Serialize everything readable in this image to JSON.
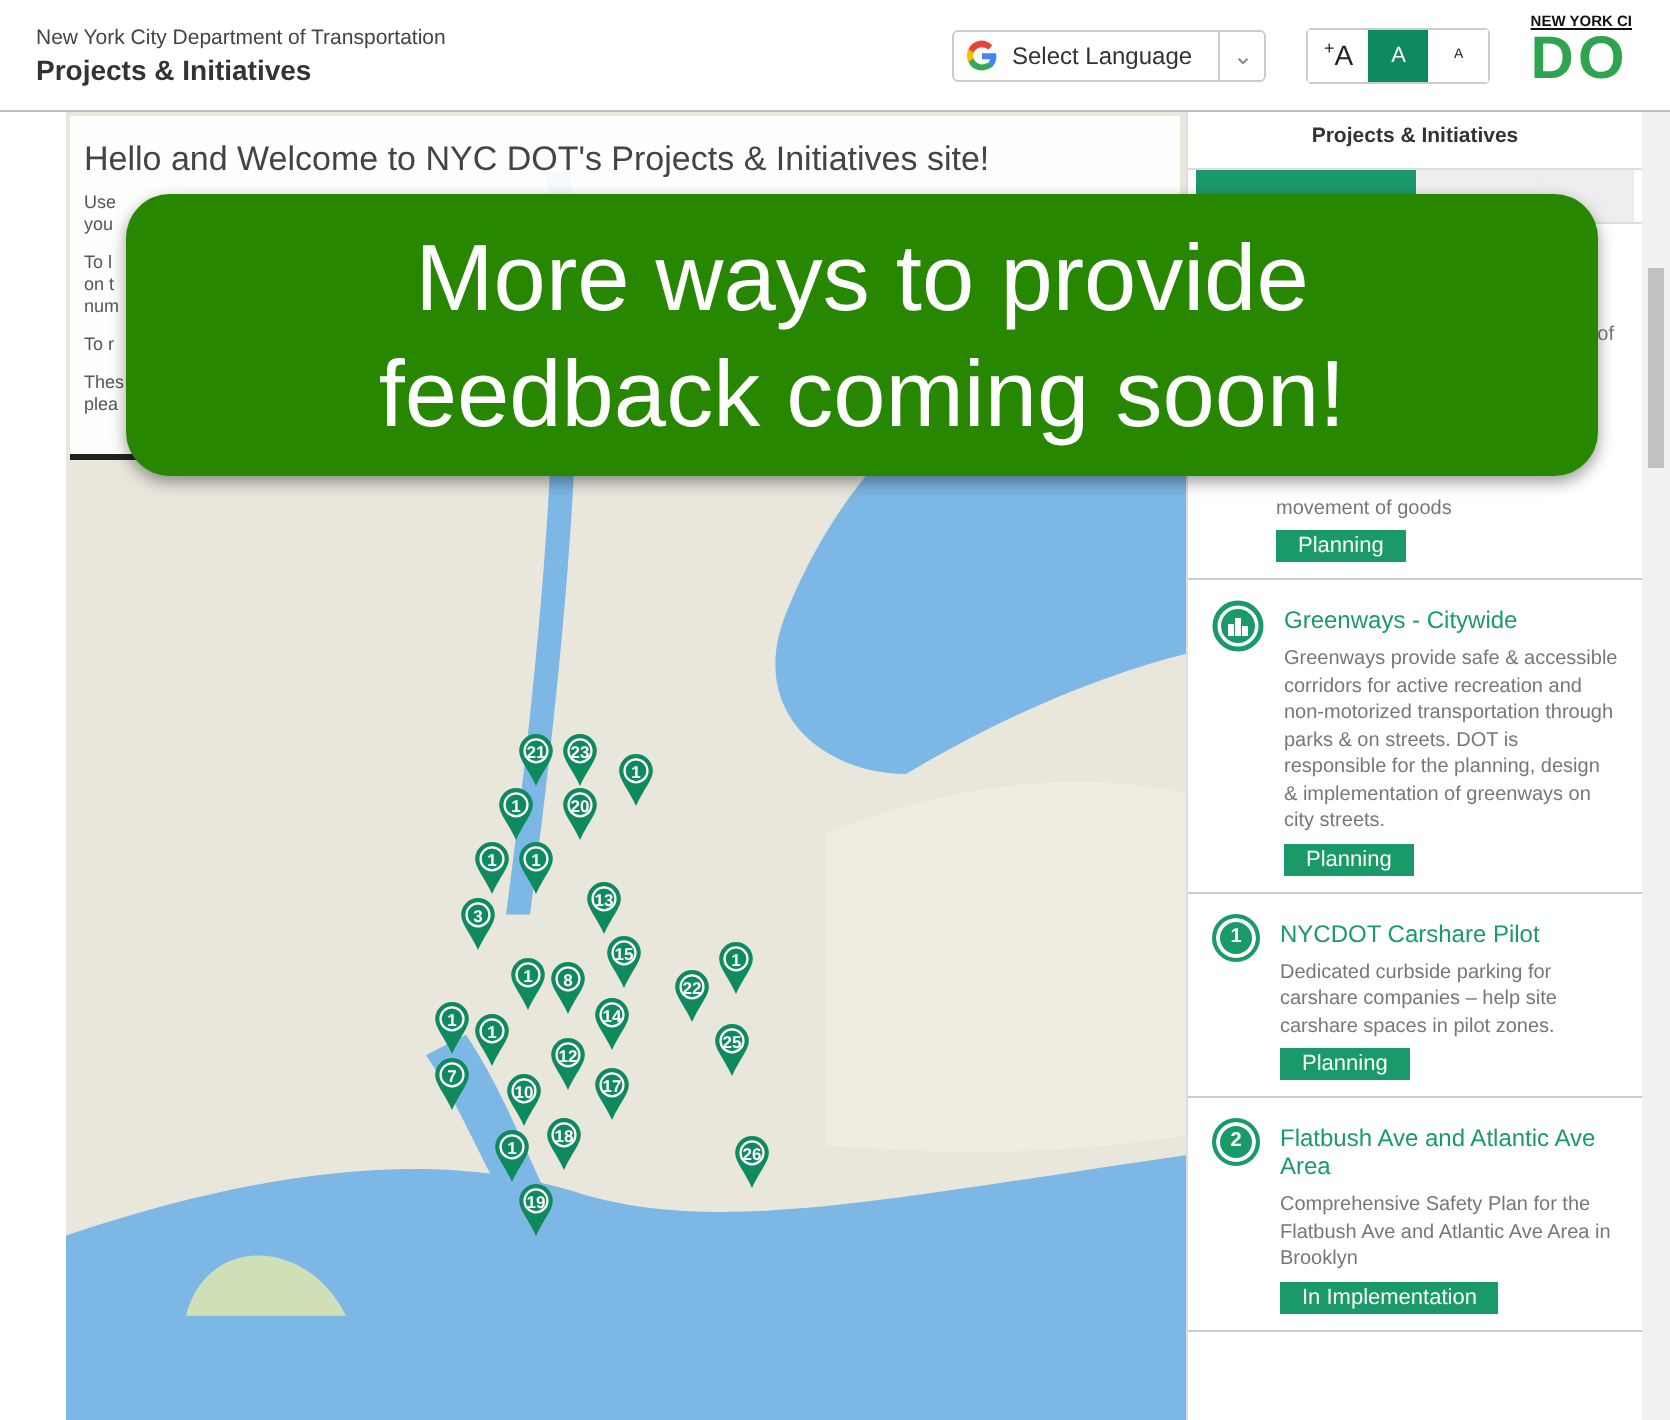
{
  "header": {
    "agency": "New York City Department of Transportation",
    "title": "Projects & Initiatives",
    "language_select": {
      "label": "Select Language",
      "caret": "⌄"
    },
    "font_sizes": [
      {
        "label": "A",
        "prefix": "+",
        "selected": false
      },
      {
        "label": "A",
        "selected": true
      },
      {
        "label": "A",
        "selected": false
      }
    ],
    "logo": {
      "top": "NEW YORK CI",
      "mark": "DO"
    }
  },
  "welcome": {
    "heading": "Hello and Welcome to NYC DOT's Projects & Initiatives site!",
    "fragments": [
      "Use",
      "you",
      "To l",
      "on t",
      "num",
      "To r",
      "Thes",
      "plea"
    ]
  },
  "banner": {
    "lines": [
      "More ways to provide",
      "feedback coming soon!"
    ]
  },
  "markers": [
    {
      "label": "21"
    },
    {
      "label": "23"
    },
    {
      "label": "1"
    },
    {
      "label": "1"
    },
    {
      "label": "20"
    },
    {
      "label": "1"
    },
    {
      "label": "1"
    },
    {
      "label": "13"
    },
    {
      "label": "3"
    },
    {
      "label": "15"
    },
    {
      "label": "1"
    },
    {
      "label": "1"
    },
    {
      "label": "8"
    },
    {
      "label": "22"
    },
    {
      "label": "14"
    },
    {
      "label": "1"
    },
    {
      "label": "1"
    },
    {
      "label": "25"
    },
    {
      "label": "12"
    },
    {
      "label": "7"
    },
    {
      "label": "17"
    },
    {
      "label": "10"
    },
    {
      "label": "18"
    },
    {
      "label": "1"
    },
    {
      "label": "26"
    },
    {
      "label": "19"
    }
  ],
  "sidebar": {
    "title": "Projects & Initiatives",
    "tabs": [
      {
        "selected": true
      },
      {
        "selected": false
      }
    ],
    "cards": [
      {
        "kind": "covered",
        "fragment": "of",
        "description": "movement of goods",
        "status": "Planning"
      },
      {
        "kind": "icon",
        "title": "Greenways - Citywide",
        "description": "Greenways provide safe & accessible corridors for active recreation and non-motorized transportation through parks & on streets. DOT is responsible for the planning, design & implementation of greenways on city streets.",
        "status": "Planning"
      },
      {
        "kind": "number",
        "number": "1",
        "title": "NYCDOT Carshare Pilot",
        "description": "Dedicated curbside parking for carshare companies – help site carshare spaces in pilot zones.",
        "status": "Planning"
      },
      {
        "kind": "number",
        "number": "2",
        "title": "Flatbush Ave and Atlantic Ave Area",
        "description": "Comprehensive Safety Plan for the Flatbush Ave and Atlantic Ave Area in Brooklyn",
        "status": "In Implementation"
      }
    ]
  }
}
